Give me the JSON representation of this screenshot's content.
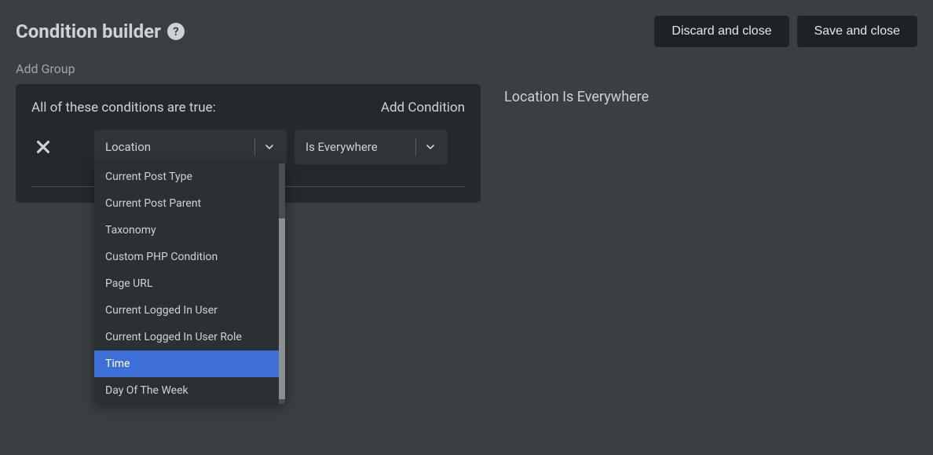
{
  "header": {
    "title": "Condition builder",
    "discard_label": "Discard and close",
    "save_label": "Save and close"
  },
  "add_group_label": "Add Group",
  "group": {
    "title": "All of these conditions are true:",
    "add_condition_label": "Add Condition",
    "condition": {
      "field_selected": "Location",
      "value_selected": "Is Everywhere"
    }
  },
  "dropdown": {
    "items": [
      "Current Post Type",
      "Current Post Parent",
      "Taxonomy",
      "Custom PHP Condition",
      "Page URL",
      "Current Logged In User",
      "Current Logged In User Role",
      "Time",
      "Day Of The Week"
    ],
    "highlighted_index": 7
  },
  "summary_text": "Location Is Everywhere"
}
